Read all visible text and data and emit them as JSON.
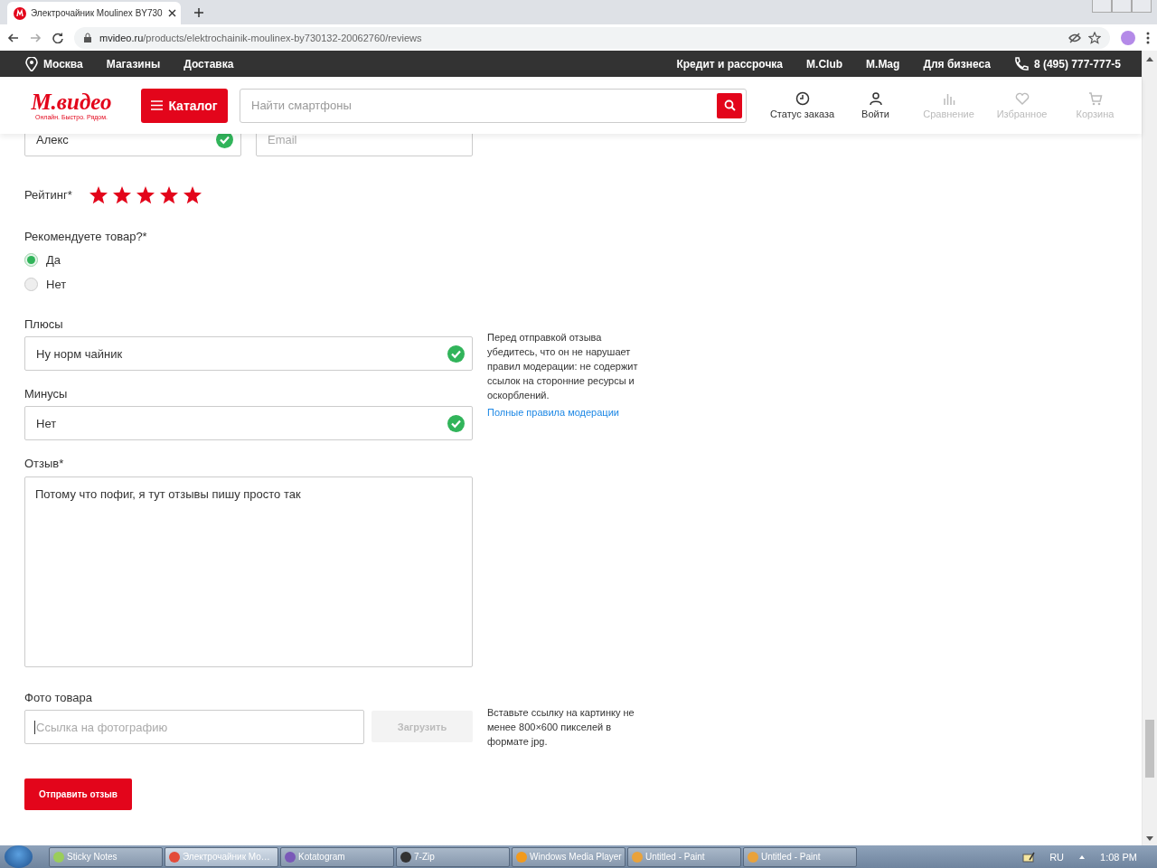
{
  "browser": {
    "tab_title": "Электрочайник Moulinex BY730",
    "url_host": "mvideo.ru",
    "url_path": "/products/elektrochainik-moulinex-by730132-20062760/reviews"
  },
  "top_bar": {
    "city": "Москва",
    "links_left": [
      "Магазины",
      "Доставка"
    ],
    "links_right": [
      "Кредит и рассрочка",
      "M.Club",
      "M.Mag",
      "Для бизнеса"
    ],
    "phone": "8 (495) 777-777-5"
  },
  "header": {
    "logo": "М.видео",
    "tagline": "Онлайн. Быстро. Рядом.",
    "catalog": "Каталог",
    "search_placeholder": "Найти смартфоны",
    "actions": [
      {
        "label": "Статус заказа",
        "kind": "clock",
        "disabled": false
      },
      {
        "label": "Войти",
        "kind": "person",
        "disabled": false
      },
      {
        "label": "Сравнение",
        "kind": "chart",
        "disabled": true
      },
      {
        "label": "Избранное",
        "kind": "heart",
        "disabled": true
      },
      {
        "label": "Корзина",
        "kind": "cart",
        "disabled": true
      }
    ]
  },
  "form": {
    "name": {
      "value": "Алекс",
      "valid": true
    },
    "email": {
      "placeholder": "Email"
    },
    "rating": {
      "label": "Рейтинг*",
      "stars": 5
    },
    "recommend": {
      "label": "Рекомендуете товар?*",
      "options": [
        {
          "label": "Да",
          "selected": true
        },
        {
          "label": "Нет",
          "selected": false
        }
      ]
    },
    "pros": {
      "label": "Плюсы",
      "value": "Ну норм чайник",
      "valid": true
    },
    "cons": {
      "label": "Минусы",
      "value": "Нет",
      "valid": true
    },
    "note": "Перед отправкой отзыва убедитесь, что он не нарушает правил модерации: не содержит ссылок на сторонние ресурсы и оскорблений.",
    "rules_link": "Полные правила модерации",
    "review": {
      "label": "Отзыв*",
      "value": "Потому что пофиг, я тут отзывы пишу просто так"
    },
    "photo": {
      "label": "Фото товара",
      "placeholder": "Ссылка на фотографию",
      "upload": "Загрузить",
      "upload_disabled": true,
      "hint": "Вставьте ссылку на картинку не менее 800×600 пикселей в формате jpg."
    },
    "submit": "Отправить отзыв"
  },
  "taskbar": {
    "items": [
      {
        "label": "Sticky Notes",
        "selected": false
      },
      {
        "label": "Электрочайник Мо…",
        "selected": true
      },
      {
        "label": "Kotatogram",
        "selected": false
      },
      {
        "label": "7-Zip",
        "selected": false
      },
      {
        "label": "Windows Media Player",
        "selected": false
      },
      {
        "label": "Untitled - Paint",
        "selected": false
      },
      {
        "label": "Untitled - Paint",
        "selected": false
      }
    ],
    "lang": "RU",
    "time": "1:08 PM"
  }
}
